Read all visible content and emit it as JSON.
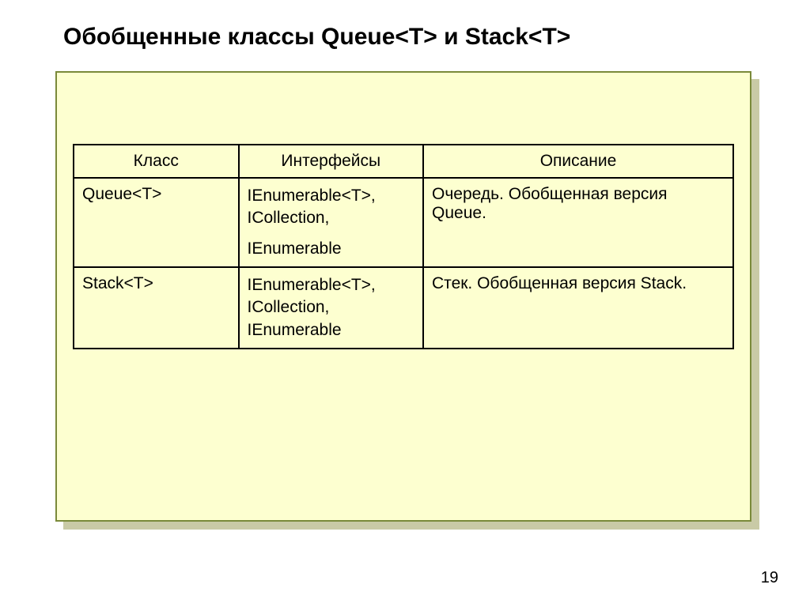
{
  "title": "Обобщенные классы Queue<T> и Stack<T>",
  "page_number": "19",
  "table": {
    "headers": [
      "Класс",
      "Интерфейсы",
      "Описание"
    ],
    "rows": [
      {
        "class": "Queue<T>",
        "iface_line1": "IEnumerable<T>, ICollection,",
        "iface_line2": "IEnumerable",
        "desc": "Очередь. Обобщенная версия Queue."
      },
      {
        "class": "Stack<T>",
        "iface_line1": "IEnumerable<T>, ICollection, IEnumerable",
        "iface_line2": "",
        "desc": "Стек. Обобщенная версия Stack."
      }
    ]
  }
}
